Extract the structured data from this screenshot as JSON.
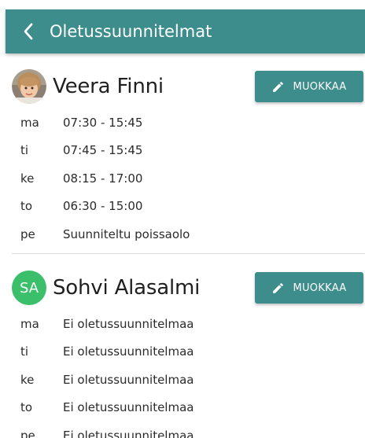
{
  "header": {
    "title": "Oletussuunnitelmat",
    "back_icon": "chevron-left-icon"
  },
  "colors": {
    "header_bg": "#3d8d8d",
    "button_bg": "#3d8d8d",
    "initials_avatar_bg": "#3bbf6a"
  },
  "children": [
    {
      "name": "Veera Finni",
      "avatar": "photo",
      "edit_label": "MUOKKAA",
      "edit_icon": "pencil-icon",
      "schedule": [
        {
          "day": "ma",
          "value": "07:30 - 15:45"
        },
        {
          "day": "ti",
          "value": "07:45 - 15:45"
        },
        {
          "day": "ke",
          "value": "08:15 - 17:00"
        },
        {
          "day": "to",
          "value": "06:30 - 15:00"
        },
        {
          "day": "pe",
          "value": "Suunniteltu poissaolo"
        }
      ]
    },
    {
      "name": "Sohvi Alasalmi",
      "avatar_initials": "SA",
      "edit_label": "MUOKKAA",
      "edit_icon": "pencil-icon",
      "schedule": [
        {
          "day": "ma",
          "value": "Ei oletussuunnitelmaa"
        },
        {
          "day": "ti",
          "value": "Ei oletussuunnitelmaa"
        },
        {
          "day": "ke",
          "value": "Ei oletussuunnitelmaa"
        },
        {
          "day": "to",
          "value": "Ei oletussuunnitelmaa"
        },
        {
          "day": "pe",
          "value": "Ei oletussuunnitelmaa"
        }
      ]
    }
  ]
}
